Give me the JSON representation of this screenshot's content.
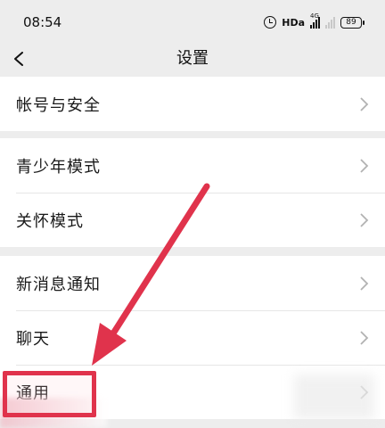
{
  "status_bar": {
    "time": "08:54",
    "hd_label": "HDa",
    "network_tag": "4G",
    "battery": "89"
  },
  "nav": {
    "title": "设置"
  },
  "groups": [
    {
      "items": [
        {
          "label": "帐号与安全"
        }
      ]
    },
    {
      "items": [
        {
          "label": "青少年模式"
        },
        {
          "label": "关怀模式"
        }
      ]
    },
    {
      "items": [
        {
          "label": "新消息通知"
        },
        {
          "label": "聊天"
        },
        {
          "label": "通用"
        }
      ]
    }
  ],
  "annotation": {
    "arrow_color": "#e0334c",
    "highlight_color": "#e0334c"
  }
}
